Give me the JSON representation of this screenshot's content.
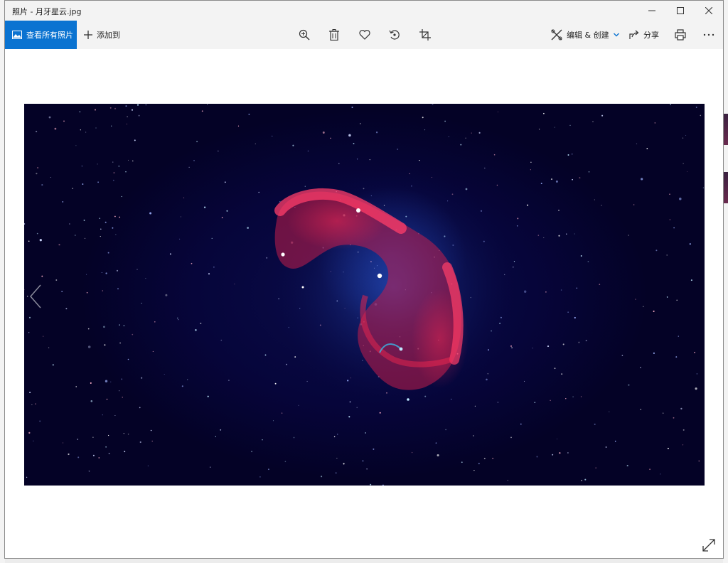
{
  "window": {
    "title": "照片 - 月牙星云.jpg"
  },
  "toolbar": {
    "view_all_label": "查看所有照片",
    "add_to_label": "添加到",
    "edit_create_label": "编辑 & 创建",
    "share_label": "分享"
  },
  "icons": {
    "view_all": "photo-gallery-icon",
    "add_to": "plus-icon",
    "zoom": "zoom-in-icon",
    "delete": "trash-icon",
    "favorite": "heart-icon",
    "rotate": "rotate-icon",
    "crop": "crop-icon",
    "edit": "edit-tools-icon",
    "share": "share-icon",
    "print": "print-icon",
    "more": "more-icon",
    "prev": "chevron-left-icon",
    "expand": "expand-icon"
  },
  "colors": {
    "accent": "#0a73d1",
    "chrome": "#f3f3f3",
    "photo_bg": "#06053a",
    "nebula_red": "#ff2a55",
    "nebula_blue": "#2a8fd6"
  }
}
